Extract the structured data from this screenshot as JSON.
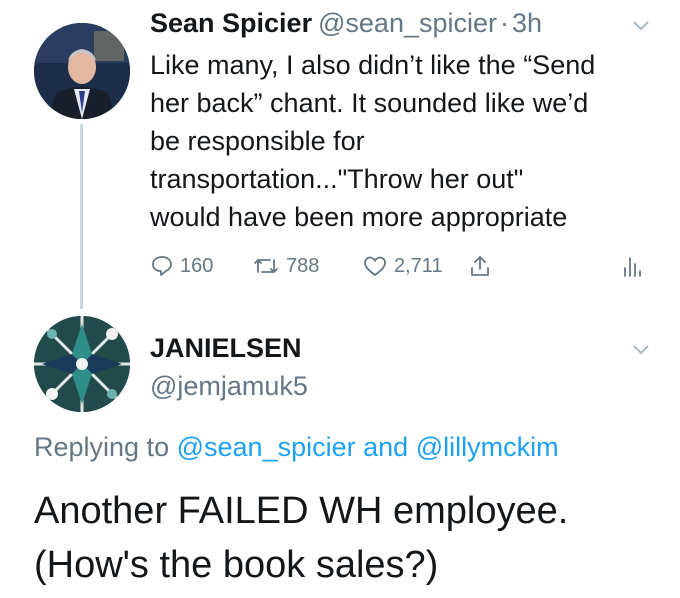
{
  "tweet": {
    "author_name": "Sean Spicier",
    "handle": "@sean_spicier",
    "separator": "·",
    "time": "3h",
    "lines": [
      "Like many, I also didn’t like the “Send",
      "her back” chant. It sounded like we’d",
      "be responsible for",
      "transportation...\"Throw her out\"",
      "would have been more appropriate"
    ],
    "replies": "160",
    "retweets": "788",
    "likes": "2,711"
  },
  "reply": {
    "author_name": "JANIELSEN",
    "handle": "@jemjamuk5",
    "replying_prefix": "Replying to",
    "mention_1": "@sean_spicier",
    "conjunction": "and",
    "mention_2": "@lillymckim",
    "lines": [
      "Another FAILED WH employee.",
      "(How's the book sales?)"
    ]
  },
  "icons": {
    "reply": "reply-icon",
    "retweet": "retweet-icon",
    "like": "heart-icon",
    "share": "share-icon",
    "analytics": "analytics-icon",
    "menu": "chevron-down-icon"
  },
  "colors": {
    "text": "#14171a",
    "secondary": "#657786",
    "link": "#1da1f2",
    "thread_line": "#ccd6dd"
  }
}
